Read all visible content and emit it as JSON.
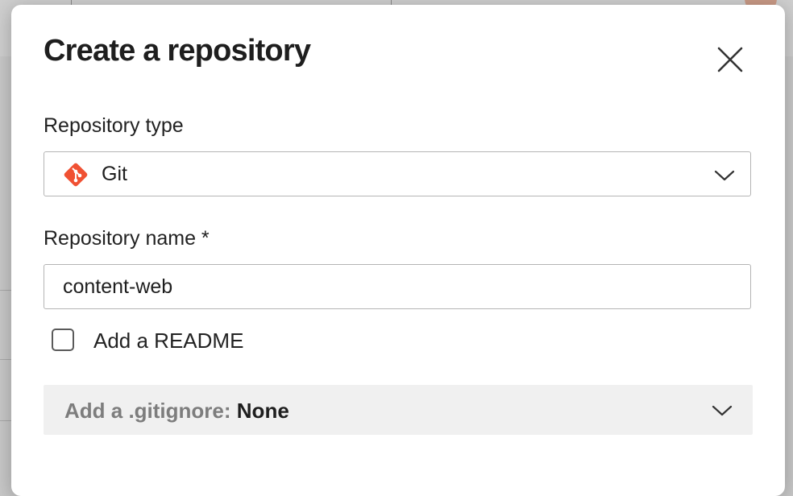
{
  "dialog": {
    "title": "Create a repository",
    "close_icon": "close-icon"
  },
  "repo_type": {
    "label": "Repository type",
    "selected": "Git",
    "icon": "git-icon",
    "icon_color": "#f05133"
  },
  "repo_name": {
    "label": "Repository name *",
    "value": "content-web"
  },
  "readme": {
    "label": "Add a README",
    "checked": false
  },
  "gitignore": {
    "label": "Add a .gitignore:",
    "value": "None"
  }
}
